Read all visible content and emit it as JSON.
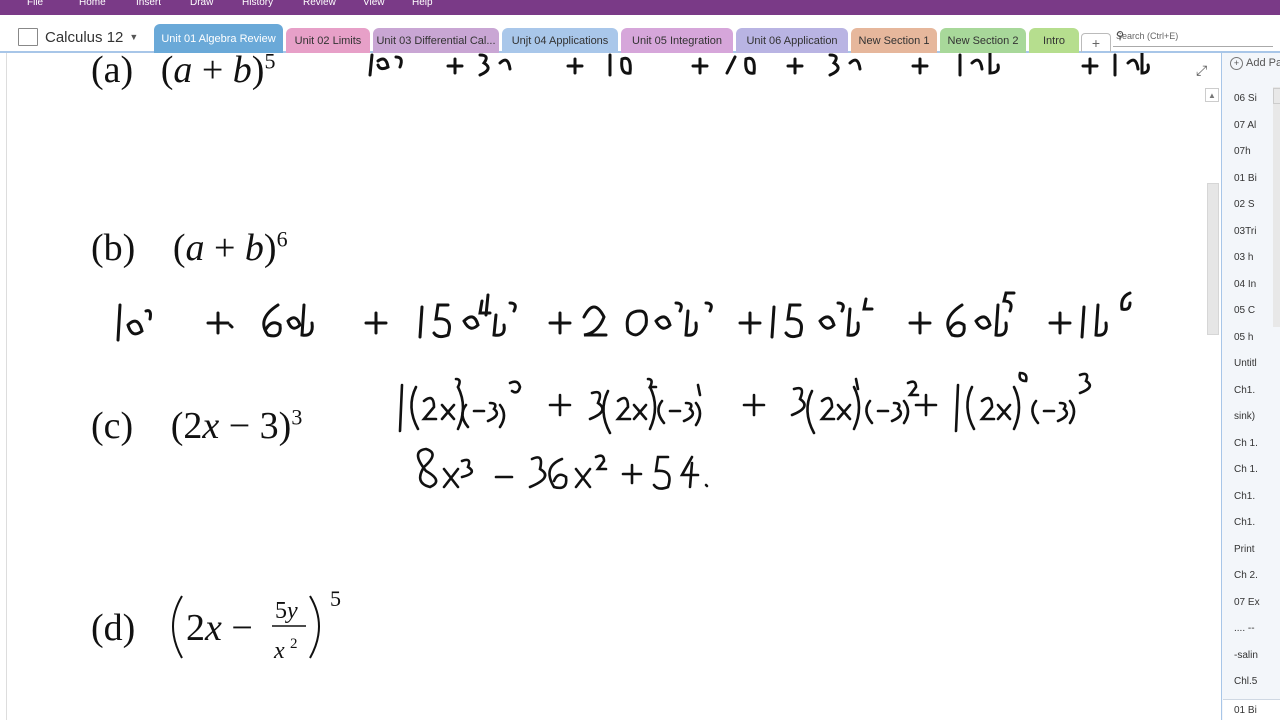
{
  "menu": [
    "File",
    "Home",
    "Insert",
    "Draw",
    "History",
    "Review",
    "View",
    "Help"
  ],
  "notebook": {
    "name": "Calculus 12"
  },
  "tabs": [
    {
      "label": "Unit 01 Algebra Review",
      "color": "#6aa9d8",
      "active": true
    },
    {
      "label": "Unit 02 Limits",
      "color": "#e7a0c8"
    },
    {
      "label": "Unit 03 Differential Cal...",
      "color": "#c9a6d4"
    },
    {
      "label": "Unjt 04 Applications",
      "color": "#a9c7ea"
    },
    {
      "label": "Unit 05 Integration",
      "color": "#d6a6da"
    },
    {
      "label": "Unit 06 Application",
      "color": "#b9b4e3"
    },
    {
      "label": "New Section 1",
      "color": "#e6b79c"
    },
    {
      "label": "New Section 2",
      "color": "#a8d89a"
    },
    {
      "label": "Intro",
      "color": "#b6de8e"
    }
  ],
  "search": {
    "placeholder": "Search (Ctrl+E)"
  },
  "page_list": {
    "add_label": "Add Pa",
    "items": [
      "06 Si",
      "07 Al",
      "07h",
      "01 Bi",
      "02 S",
      "03Tri",
      "03 h",
      "04 In",
      "05 C",
      "05 h",
      "Untitl",
      "Ch1.",
      "sink)",
      "Ch 1.",
      "Ch 1.",
      "Ch1.",
      "Ch1.",
      "Print",
      "Ch 2.",
      "07 Ex",
      ".... --",
      "-salin",
      "Chl.5",
      "01 Bi"
    ]
  },
  "problems": {
    "a": {
      "label": "(a)"
    },
    "b": {
      "label": "(b)"
    },
    "c": {
      "label": "(c)"
    },
    "d": {
      "label": "(d)"
    }
  },
  "colors": {
    "ribbon": "#7a3a87",
    "active_tab": "#6aa9d8",
    "pane_border": "#a8c6e8"
  }
}
